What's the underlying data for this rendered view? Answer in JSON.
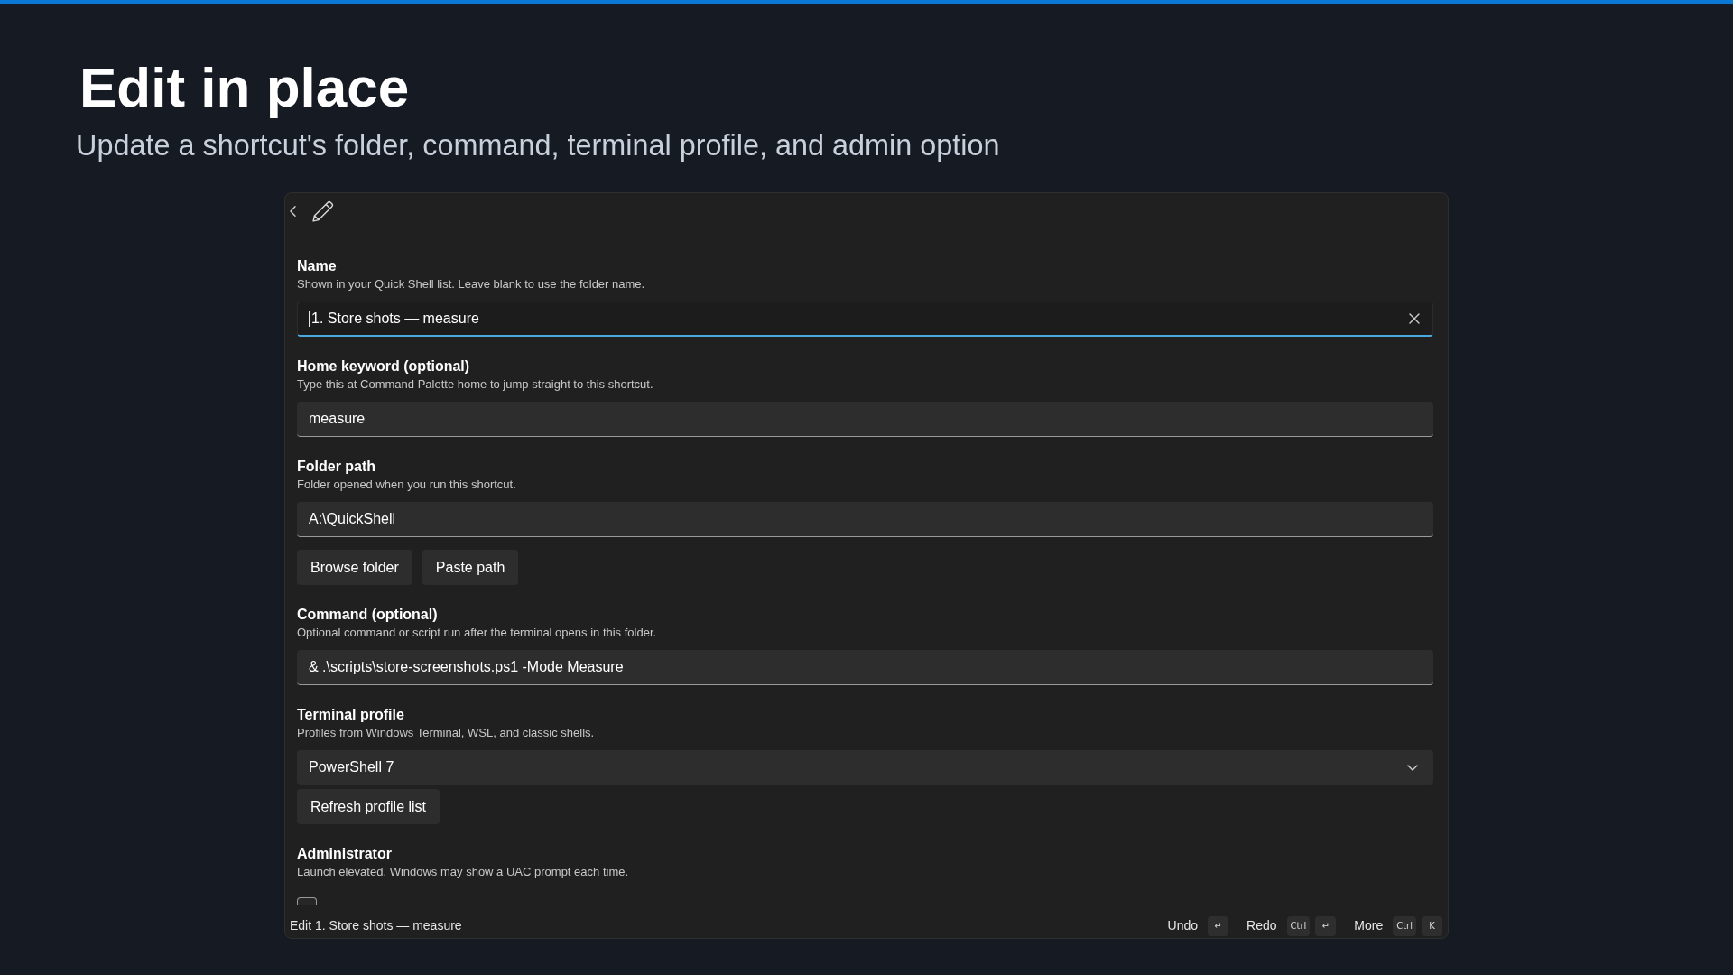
{
  "page": {
    "title": "Edit in place",
    "subtitle": "Update a shortcut's folder, command, terminal profile, and admin option"
  },
  "editor": {
    "fields": [
      {
        "kind": "text",
        "label": "Name",
        "description": "Shown in your Quick Shell list. Leave blank to use the folder name.",
        "value": "1. Store shots — measure",
        "focused": true
      },
      {
        "kind": "text",
        "label": "Home keyword (optional)",
        "description": "Type this at Command Palette home to jump straight to this shortcut.",
        "value": "measure",
        "focused": false
      },
      {
        "kind": "text",
        "label": "Folder path",
        "description": "Folder opened when you run this shortcut.",
        "value": "A:\\QuickShell",
        "focused": false,
        "buttons": [
          "Browse folder",
          "Paste path"
        ]
      },
      {
        "kind": "text",
        "label": "Command (optional)",
        "description": "Optional command or script run after the terminal opens in this folder.",
        "value": "& .\\scripts\\store-screenshots.ps1 -Mode Measure",
        "focused": false
      },
      {
        "kind": "dropdown",
        "label": "Terminal profile",
        "description": "Profiles from Windows Terminal, WSL, and classic shells.",
        "value": "PowerShell 7",
        "buttons": [
          "Refresh profile list"
        ]
      },
      {
        "kind": "checkbox",
        "label": "Administrator",
        "description": "Launch elevated. Windows may show a UAC prompt each time.",
        "checked": false
      }
    ]
  },
  "footer": {
    "title": "Edit 1. Store shots — measure",
    "actions": [
      {
        "label": "Undo",
        "keys": [
          "↵"
        ]
      },
      {
        "label": "Redo",
        "keys": [
          "Ctrl",
          "↵"
        ]
      },
      {
        "label": "More",
        "keys": [
          "Ctrl",
          "K"
        ]
      }
    ]
  }
}
